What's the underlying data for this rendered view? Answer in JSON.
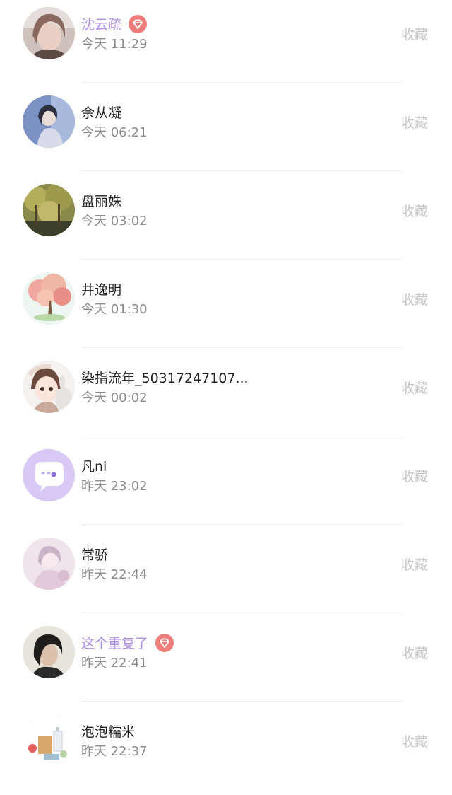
{
  "items": [
    {
      "name": "沈云疏",
      "time": "今天 11:29",
      "action": "收藏",
      "vip": true,
      "avatar": "avatar-girl-photo"
    },
    {
      "name": "佘从凝",
      "time": "今天 06:21",
      "action": "收藏",
      "vip": false,
      "avatar": "avatar-blue-photo"
    },
    {
      "name": "盘丽姝",
      "time": "今天 03:02",
      "action": "收藏",
      "vip": false,
      "avatar": "avatar-forest-photo"
    },
    {
      "name": "井逸明",
      "time": "今天 01:30",
      "action": "收藏",
      "vip": false,
      "avatar": "avatar-blossom-tree"
    },
    {
      "name": "染指流年_50317247107...",
      "time": "今天 00:02",
      "action": "收藏",
      "vip": false,
      "avatar": "avatar-anime-girl"
    },
    {
      "name": "凡ni",
      "time": "昨天 23:02",
      "action": "收藏",
      "vip": false,
      "avatar": "avatar-chat-bubble"
    },
    {
      "name": "常骄",
      "time": "昨天 22:44",
      "action": "收藏",
      "vip": false,
      "avatar": "avatar-pink-photo"
    },
    {
      "name": "这个重复了",
      "time": "昨天 22:41",
      "action": "收藏",
      "vip": true,
      "avatar": "avatar-dark-portrait"
    },
    {
      "name": "泡泡糯米",
      "time": "昨天 22:37",
      "action": "收藏",
      "vip": false,
      "avatar": "avatar-shopping-items"
    }
  ],
  "colors": {
    "vip_name": "#b08fe0",
    "badge": "#ec7d7b",
    "time": "#8b8b8b",
    "action": "#c6c6c6"
  }
}
